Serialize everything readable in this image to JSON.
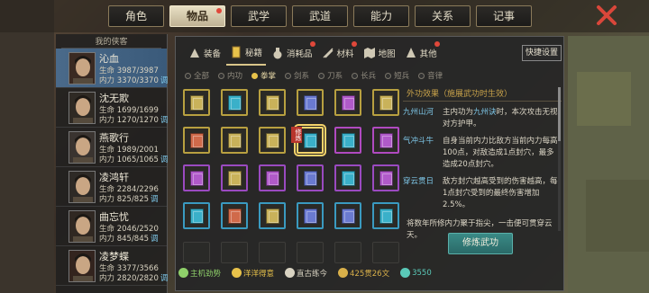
{
  "top_tabs": [
    {
      "label": "角色",
      "active": false,
      "badge": false
    },
    {
      "label": "物品",
      "active": true,
      "badge": true
    },
    {
      "label": "武学",
      "active": false,
      "badge": false
    },
    {
      "label": "武道",
      "active": false,
      "badge": false
    },
    {
      "label": "能力",
      "active": false,
      "badge": false
    },
    {
      "label": "关系",
      "active": false,
      "badge": false
    },
    {
      "label": "记事",
      "active": false,
      "badge": false
    }
  ],
  "left_panel": {
    "title": "我的侠客",
    "heroes": [
      {
        "name": "沁血",
        "hp_label": "生命",
        "hp": "3987/3987",
        "mp_label": "内力",
        "mp": "3370/3370",
        "tune": "调",
        "active": true
      },
      {
        "name": "沈无欺",
        "hp_label": "生命",
        "hp": "1699/1699",
        "mp_label": "内力",
        "mp": "1270/1270",
        "tune": "调",
        "active": false
      },
      {
        "name": "燕歌行",
        "hp_label": "生命",
        "hp": "1989/2001",
        "mp_label": "内力",
        "mp": "1065/1065",
        "tune": "调",
        "active": false
      },
      {
        "name": "凌鸿轩",
        "hp_label": "生命",
        "hp": "2284/2296",
        "mp_label": "内力",
        "mp": "825/825",
        "tune": "调",
        "active": false
      },
      {
        "name": "曲忘忧",
        "hp_label": "生命",
        "hp": "2046/2520",
        "mp_label": "内力",
        "mp": "845/845",
        "tune": "调",
        "active": false
      },
      {
        "name": "凌梦蝶",
        "hp_label": "生命",
        "hp": "3377/3566",
        "mp_label": "内力",
        "mp": "2820/2820",
        "tune": "调",
        "active": false
      }
    ]
  },
  "category_tabs": [
    {
      "label": "装备",
      "icon": "equipment-icon",
      "active": false,
      "badge": false
    },
    {
      "label": "秘籍",
      "icon": "scroll-icon",
      "active": true,
      "badge": false
    },
    {
      "label": "消耗品",
      "icon": "potion-icon",
      "active": false,
      "badge": true
    },
    {
      "label": "材料",
      "icon": "material-icon",
      "active": false,
      "badge": true
    },
    {
      "label": "地图",
      "icon": "map-icon",
      "active": false,
      "badge": false
    },
    {
      "label": "其他",
      "icon": "misc-icon",
      "active": false,
      "badge": true
    }
  ],
  "quick_settings": "快捷设置",
  "filters": [
    {
      "label": "全部",
      "on": false
    },
    {
      "label": "内功",
      "on": false
    },
    {
      "label": "拳掌",
      "on": true
    },
    {
      "label": "剑系",
      "on": false
    },
    {
      "label": "刀系",
      "on": false
    },
    {
      "label": "长兵",
      "on": false
    },
    {
      "label": "短兵",
      "on": false
    },
    {
      "label": "音律",
      "on": false
    }
  ],
  "grid": {
    "rows": [
      [
        "#c9b25a",
        "#3ab0c9",
        "#c9b25a",
        "#6a7ad0",
        "#b05ac9",
        "#c9b25a"
      ],
      [
        "#d06a4a",
        "#c9b25a",
        "#c9b25a",
        "#3ab0c9",
        "#3ab0c9",
        "#b05ac9"
      ],
      [
        "#b05ac9",
        "#c9b25a",
        "#b05ac9",
        "#6a7ad0",
        "#3ab0c9",
        "#b05ac9"
      ],
      [
        "#3ab0c9",
        "#d06a4a",
        "#c9b25a",
        "#6a7ad0",
        "#6a7ad0",
        "#3ab0c9"
      ]
    ],
    "frames": [
      [
        "#b8a040",
        "#b8a040",
        "#b8a040",
        "#b8a040",
        "#b8a040",
        "#b8a040"
      ],
      [
        "#b8a040",
        "#b8a040",
        "#b8a040",
        "#f5d36a",
        "#b04ac0",
        "#b04ac0"
      ],
      [
        "#9a4ac0",
        "#9a4ac0",
        "#9a4ac0",
        "#9a4ac0",
        "#9a4ac0",
        "#9a4ac0"
      ],
      [
        "#3a9ac0",
        "#3a9ac0",
        "#3a9ac0",
        "#3a9ac0",
        "#3a9ac0",
        "#3a9ac0"
      ]
    ],
    "xiulian_tag": "修炼"
  },
  "info": {
    "header": "外功效果（施展武功时生效）",
    "effects": [
      {
        "name": "九州山河",
        "pre": "主内功为",
        "hl": "九州诀",
        "post": "时，本次攻击无视对方护甲。"
      },
      {
        "name": "气冲斗牛",
        "pre": "自身当前内力比敌方当前内力每高100点，对敌造成1点封穴，最多造成20点封穴。",
        "hl": "",
        "post": ""
      },
      {
        "name": "穿云贯日",
        "pre": "敌方封穴越高受到的伤害越高，每1点封穴受到的最终伤害增加2.5%。",
        "hl": "",
        "post": ""
      }
    ],
    "description": "将数年所修内力聚于指尖，一击便可贯穿云天。",
    "practice_button": "修炼武功"
  },
  "bottom_bar": [
    {
      "label": "主机劲势",
      "icon": "vigor-icon",
      "color": "#8fd06a"
    },
    {
      "label": "洋洋得意",
      "icon": "mood-icon",
      "color": "#e8c24a"
    },
    {
      "label": "直古练今",
      "icon": "book-icon",
      "color": "#d9d3c2"
    },
    {
      "label": "425贯26文",
      "icon": "coin-icon",
      "color": "#d9b04a"
    },
    {
      "label": "3550",
      "icon": "gem-icon",
      "color": "#5ac9b8"
    }
  ]
}
